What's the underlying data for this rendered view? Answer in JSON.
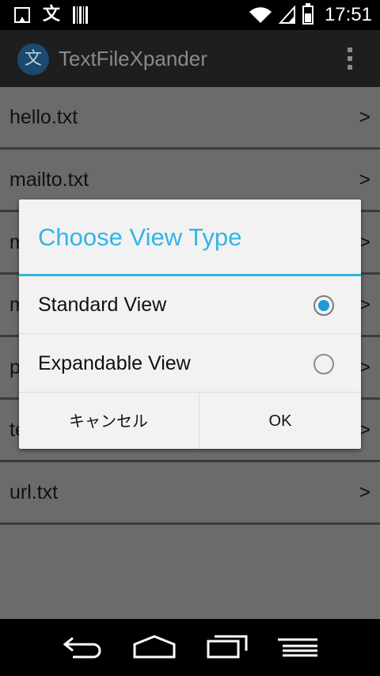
{
  "status_bar": {
    "time": "17:51",
    "left_icons": [
      "picture-icon",
      "kanji-icon",
      "barcode-icon"
    ],
    "right_icons": [
      "wifi-icon",
      "signal-icon",
      "battery-icon"
    ],
    "kanji_glyph": "文"
  },
  "action_bar": {
    "logo_glyph": "文",
    "title": "TextFileXpander",
    "menu_icon": "overflow-menu-icon"
  },
  "file_list": {
    "items": [
      {
        "name": "hello.txt",
        "chevron": ">"
      },
      {
        "name": "mailto.txt",
        "chevron": ">"
      },
      {
        "name": "m",
        "chevron": ">"
      },
      {
        "name": "m",
        "chevron": ">"
      },
      {
        "name": "p",
        "chevron": ">"
      },
      {
        "name": "te",
        "chevron": ">"
      },
      {
        "name": "url.txt",
        "chevron": ">"
      }
    ]
  },
  "dialog": {
    "title": "Choose View Type",
    "options": [
      {
        "label": "Standard View",
        "selected": true
      },
      {
        "label": "Expandable View",
        "selected": false
      }
    ],
    "cancel_label": "キャンセル",
    "ok_label": "OK"
  },
  "nav_bar": {
    "buttons": [
      "back-icon",
      "home-icon",
      "recents-icon",
      "menu-icon"
    ]
  },
  "colors": {
    "accent": "#33b5e5",
    "radio_fill": "#1e9bd7",
    "status_bar": "#000000",
    "action_bar": "#1e1e1e",
    "dimmed_background": "#6b6b6b",
    "dialog_background": "#f2f2f2"
  }
}
